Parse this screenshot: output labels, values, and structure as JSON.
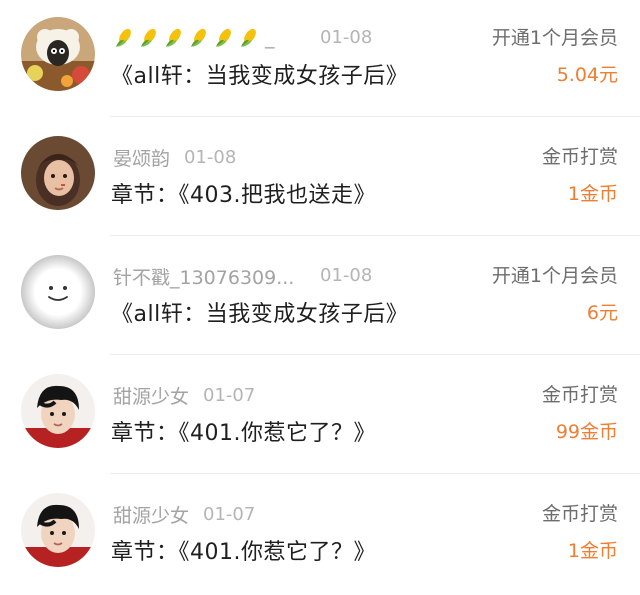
{
  "colors": {
    "accent": "#ee7e32",
    "name_gray": "#a3a3a3",
    "content_text": "#1f1f1f"
  },
  "records": [
    {
      "name": "_",
      "name_icons": [
        "corn-icon",
        "corn-icon",
        "corn-icon",
        "corn-icon",
        "corn-icon",
        "corn-icon"
      ],
      "date": "01-08",
      "content": "《all轩：当我变成女孩子后》",
      "action": "开通1个月会员",
      "amount": "5.04元",
      "avatar": "shaun-sheep-avatar"
    },
    {
      "name": "晏颂韵",
      "date": "01-08",
      "content": "章节：《403.把我也送走》",
      "action": "金币打赏",
      "amount": "1金币",
      "avatar": "girl-photo-avatar"
    },
    {
      "name": "针不戳_13076309...",
      "date": "01-08",
      "content": "《all轩：当我变成女孩子后》",
      "action": "开通1个月会员",
      "amount": "6元",
      "avatar": "smiley-avatar"
    },
    {
      "name": "甜源少女",
      "date": "01-07",
      "content": "章节：《401.你惹它了？》",
      "action": "金币打赏",
      "amount": "99金币",
      "avatar": "boy-photo-avatar"
    },
    {
      "name": "甜源少女",
      "date": "01-07",
      "content": "章节：《401.你惹它了？》",
      "action": "金币打赏",
      "amount": "1金币",
      "avatar": "boy-photo-avatar"
    }
  ]
}
